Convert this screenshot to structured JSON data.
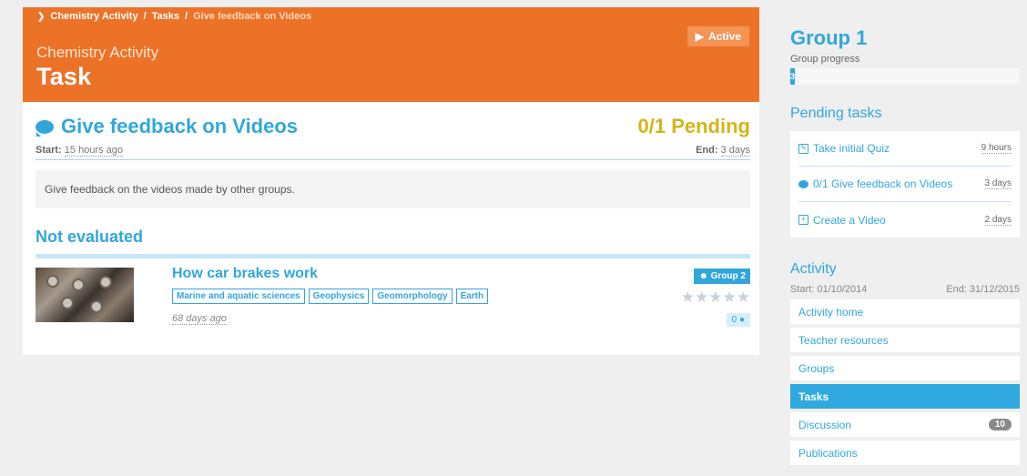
{
  "breadcrumb": {
    "items": [
      "Chemistry Activity",
      "Tasks",
      "Give feedback on Videos"
    ],
    "sep": "/"
  },
  "header": {
    "subtitle": "Chemistry Activity",
    "title": "Task",
    "status": "Active"
  },
  "task": {
    "title": "Give feedback on Videos",
    "pending": "0/1 Pending",
    "start_label": "Start:",
    "start_value": "15 hours ago",
    "end_label": "End:",
    "end_value": "3 days",
    "description": "Give feedback on the videos made by other groups."
  },
  "section": {
    "heading": "Not evaluated"
  },
  "video": {
    "title": "How car brakes work",
    "tags": [
      "Marine and aquatic sciences",
      "Geophysics",
      "Geomorphology",
      "Earth"
    ],
    "age": "68 days ago",
    "group": "Group 2",
    "stars": "★★★★★",
    "comments": "0"
  },
  "sidebar": {
    "group_title": "Group 1",
    "group_progress_label": "Group progress",
    "group_progress_value": "3",
    "pending_heading": "Pending tasks",
    "pending_tasks": [
      {
        "label": "Take initial Quiz",
        "time": "9 hours"
      },
      {
        "label": "0/1 Give feedback on Videos",
        "time": "3 days"
      },
      {
        "label": "Create a Video",
        "time": "2 days"
      }
    ],
    "activity_heading": "Activity",
    "activity_start": "Start: 01/10/2014",
    "activity_end": "End: 31/12/2015",
    "nav": [
      {
        "label": "Activity home"
      },
      {
        "label": "Teacher resources"
      },
      {
        "label": "Groups"
      },
      {
        "label": "Tasks"
      },
      {
        "label": "Discussion",
        "badge": "10"
      },
      {
        "label": "Publications"
      }
    ]
  },
  "colors": {
    "header_orange": "#ec7228",
    "accent_blue": "#32a6dc",
    "pending_yellow": "#d4b419"
  }
}
